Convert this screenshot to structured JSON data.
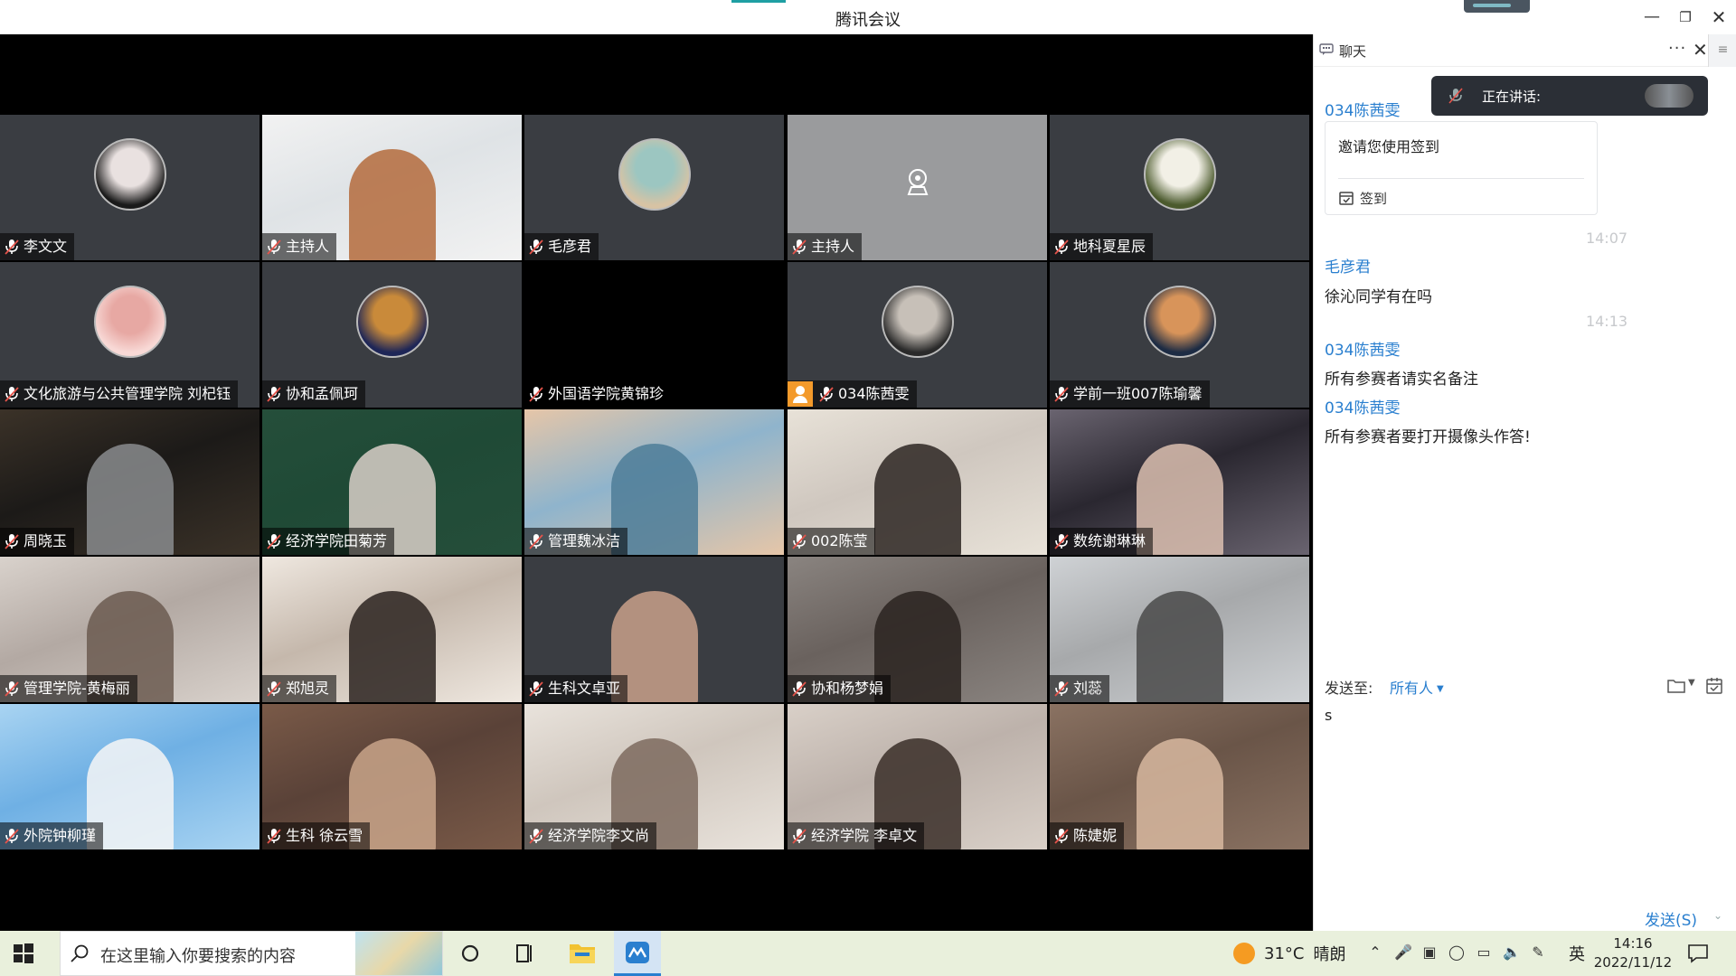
{
  "window": {
    "title": "腾讯会议"
  },
  "grid": {
    "tiles": [
      {
        "label": "李文文",
        "kind": "avatar",
        "bg": "#3a3d42",
        "avatar_colors": [
          "#1a1a1a",
          "#e9e1e0"
        ]
      },
      {
        "label": "主持人",
        "kind": "video",
        "bg": "#dfe3e6",
        "avatar_colors": [
          "#f2f2f2",
          "#b46b3c"
        ]
      },
      {
        "label": "毛彦君",
        "kind": "avatar",
        "bg": "#3a3d42",
        "avatar_colors": [
          "#d7c3a4",
          "#9cc6c1"
        ]
      },
      {
        "label": "主持人",
        "kind": "camera-off",
        "bg": "#9a9b9d",
        "avatar_colors": []
      },
      {
        "label": "地科夏星辰",
        "kind": "avatar",
        "bg": "#3a3d42",
        "avatar_colors": [
          "#4b5a2d",
          "#f2f0e6"
        ]
      },
      {
        "label": "文化旅游与公共管理学院 刘杞钰",
        "kind": "avatar",
        "bg": "#3a3d42",
        "avatar_colors": [
          "#f8d9d6",
          "#e7a8a3"
        ]
      },
      {
        "label": "协和孟佩珂",
        "kind": "avatar",
        "bg": "#3a3d42",
        "avatar_colors": [
          "#1e2657",
          "#c98a3a"
        ]
      },
      {
        "label": "外国语学院黄锦珍",
        "kind": "blank",
        "bg": "#000000",
        "avatar_colors": []
      },
      {
        "label": "034陈茜雯",
        "kind": "avatar-host",
        "bg": "#3a3d42",
        "avatar_colors": [
          "#2a2a2a",
          "#c7c0b8"
        ]
      },
      {
        "label": "学前一班007陈瑜馨",
        "kind": "avatar",
        "bg": "#3a3d42",
        "avatar_colors": [
          "#1d2c44",
          "#d8945a"
        ]
      },
      {
        "label": "周晓玉",
        "kind": "video",
        "bg": "#1c1a18",
        "avatar_colors": [
          "#3b3228",
          "#8a8c8e"
        ]
      },
      {
        "label": "经济学院田菊芳",
        "kind": "video",
        "bg": "#1f4a36",
        "avatar_colors": [
          "#254e3a",
          "#d9cfc8"
        ]
      },
      {
        "label": "管理魏冰洁",
        "kind": "video",
        "bg": "#8fb4cc",
        "avatar_colors": [
          "#e6c6a8",
          "#4d7c98"
        ]
      },
      {
        "label": "002陈莹",
        "kind": "video",
        "bg": "#cfc7bf",
        "avatar_colors": [
          "#e8e2d8",
          "#2d2622"
        ]
      },
      {
        "label": "数统谢琳琳",
        "kind": "video",
        "bg": "#2a2730",
        "avatar_colors": [
          "#6a6470",
          "#dcbfb0"
        ]
      },
      {
        "label": "管理学院-黄梅丽",
        "kind": "video",
        "bg": "#b3a9a3",
        "avatar_colors": [
          "#d9d2cc",
          "#6b5a50"
        ]
      },
      {
        "label": "郑旭灵",
        "kind": "video",
        "bg": "#c5b8ac",
        "avatar_colors": [
          "#efe8e0",
          "#2b2320"
        ]
      },
      {
        "label": "生科文卓亚",
        "kind": "video",
        "bg": "#3a3d42",
        "avatar_colors": [
          "#3a3d42",
          "#c9a08a"
        ]
      },
      {
        "label": "协和杨梦娟",
        "kind": "video",
        "bg": "#6a625e",
        "avatar_colors": [
          "#8a8480",
          "#2a2320"
        ]
      },
      {
        "label": "刘蕊",
        "kind": "video",
        "bg": "#a7a9ab",
        "avatar_colors": [
          "#cfd2d5",
          "#4a4a4a"
        ]
      },
      {
        "label": "外院钟柳瑾",
        "kind": "video",
        "bg": "#6fb0e4",
        "avatar_colors": [
          "#a9d4f2",
          "#f6f6f6"
        ]
      },
      {
        "label": "生科 徐云雪",
        "kind": "video",
        "bg": "#5a4238",
        "avatar_colors": [
          "#7a5a48",
          "#c9a48a"
        ]
      },
      {
        "label": "经济学院李文尚",
        "kind": "video",
        "bg": "#cfc6bd",
        "avatar_colors": [
          "#e9e3dc",
          "#7c6a5e"
        ]
      },
      {
        "label": "经济学院 李卓文",
        "kind": "video",
        "bg": "#bdb2ab",
        "avatar_colors": [
          "#d9d0c8",
          "#3a2e28"
        ]
      },
      {
        "label": "陈婕妮",
        "kind": "video",
        "bg": "#6a5548",
        "avatar_colors": [
          "#8a7262",
          "#d8b8a0"
        ]
      }
    ]
  },
  "chat": {
    "header_title": "聊天",
    "speaking_label": "正在讲话:",
    "messages": [
      {
        "sender": "034陈茜雯"
      },
      {
        "card_text": "邀请您使用签到",
        "card_button": "签到"
      },
      {
        "timestamp": "14:07"
      },
      {
        "sender": "毛彦君",
        "text": "徐沁同学有在吗"
      },
      {
        "timestamp": "14:13"
      },
      {
        "sender": "034陈茜雯",
        "text": "所有参赛者请实名备注"
      },
      {
        "sender": "034陈茜雯",
        "text": "所有参赛者要打开摄像头作答!"
      }
    ],
    "send_to_label": "发送至:",
    "recipient": "所有人",
    "input_value": "s",
    "send_button": "发送(S)"
  },
  "taskbar": {
    "search_placeholder": "在这里输入你要搜索的内容",
    "weather_temp": "31°C",
    "weather_desc": "晴朗",
    "ime": "英",
    "time": "14:16",
    "date": "2022/11/12"
  },
  "colors": {
    "accent": "#2a7fcf",
    "host_badge": "#f39a2b",
    "taskbar_bg": "#e9f0dc"
  }
}
